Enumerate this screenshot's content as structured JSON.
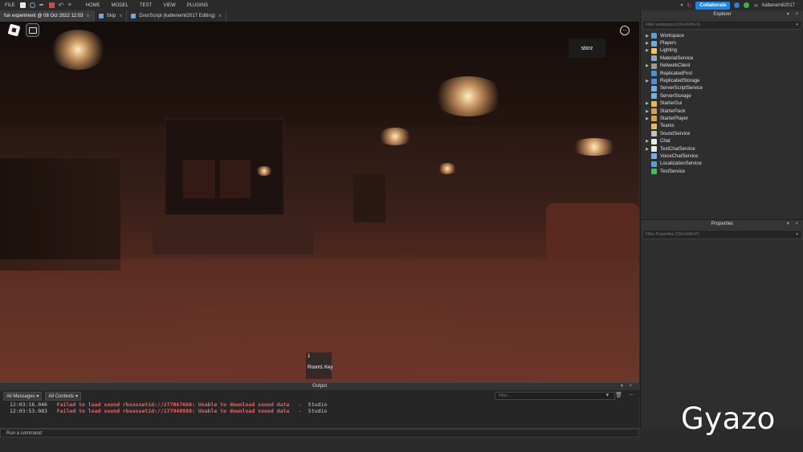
{
  "menubar": {
    "file": "FILE",
    "items": [
      "HOME",
      "MODEL",
      "TEST",
      "VIEW",
      "PLUGINS"
    ],
    "collaborate": "Collaborate",
    "username": "kattenemil2017"
  },
  "tabs": [
    {
      "label": "fun experiment @ 08 Oct 2022 12:03"
    },
    {
      "label": "Skip"
    },
    {
      "label": "DoorScript (kattenemil2017 Editing)"
    }
  ],
  "viewport": {
    "player_name": "stxrz",
    "hotbar_slot": "1",
    "hotbar_item": "Room1 Key",
    "more_icon": "..."
  },
  "output": {
    "title": "Output",
    "filter_messages": "All Messages",
    "filter_contexts": "All Contexts",
    "filter_placeholder": "Filter...",
    "logs": [
      {
        "time": "12:03:16.046",
        "message": "Failed to load sound rbxassetid://277067660: Unable to download sound data",
        "source": "-  Studio"
      },
      {
        "time": "12:03:53.083",
        "message": "Failed to load sound rbxassetid://177940988: Unable to download sound data",
        "source": "-  Studio"
      }
    ]
  },
  "command": {
    "placeholder": "Run a command"
  },
  "explorer": {
    "title": "Explorer",
    "filter_placeholder": "Filter workspace (Ctrl+Shift+X)",
    "items": [
      {
        "label": "Workspace",
        "expandable": true,
        "color": "#4aa3e8"
      },
      {
        "label": "Players",
        "expandable": true,
        "color": "#5ab0f0"
      },
      {
        "label": "Lighting",
        "expandable": true,
        "color": "#f2c94c"
      },
      {
        "label": "MaterialService",
        "expandable": false,
        "color": "#8fa6c8"
      },
      {
        "label": "NetworkClient",
        "expandable": true,
        "color": "#9a9a9a"
      },
      {
        "label": "ReplicatedFirst",
        "expandable": false,
        "color": "#4a8fd8"
      },
      {
        "label": "ReplicatedStorage",
        "expandable": true,
        "color": "#4a8fd8"
      },
      {
        "label": "ServerScriptService",
        "expandable": false,
        "color": "#6fb0e8"
      },
      {
        "label": "ServerStorage",
        "expandable": false,
        "color": "#6fb0e8"
      },
      {
        "label": "StarterGui",
        "expandable": true,
        "color": "#e8b84a"
      },
      {
        "label": "StarterPack",
        "expandable": true,
        "color": "#d8a040"
      },
      {
        "label": "StarterPlayer",
        "expandable": true,
        "color": "#d8a040"
      },
      {
        "label": "Teams",
        "expandable": false,
        "color": "#e0c050"
      },
      {
        "label": "SoundService",
        "expandable": false,
        "color": "#c0c0c0"
      },
      {
        "label": "Chat",
        "expandable": true,
        "color": "#e8e8e8"
      },
      {
        "label": "TextChatService",
        "expandable": true,
        "color": "#e8e8e8"
      },
      {
        "label": "VoiceChatService",
        "expandable": false,
        "color": "#6fb0e8"
      },
      {
        "label": "LocalizationService",
        "expandable": false,
        "color": "#4aa3e8"
      },
      {
        "label": "TestService",
        "expandable": false,
        "color": "#3cc060"
      }
    ]
  },
  "properties": {
    "title": "Properties",
    "filter_placeholder": "Filter Properties (Ctrl+Shift+P)"
  },
  "watermark": "Gyazo"
}
